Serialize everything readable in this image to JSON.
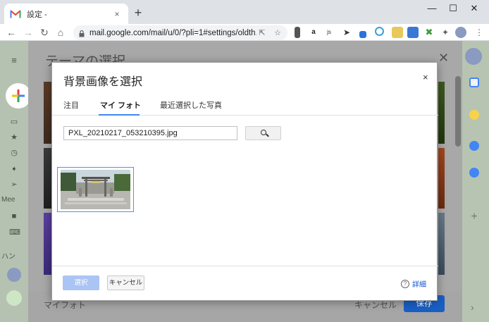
{
  "browser": {
    "tab_title": "設定 -",
    "tab_close": "×",
    "new_tab": "+",
    "window_controls": {
      "minimize": "—",
      "maximize": "☐",
      "close": "✕"
    },
    "nav": {
      "back": "←",
      "forward": "→",
      "reload": "↻",
      "home": "⌂"
    },
    "url": "mail.google.com/mail/u/0/?pli=1#settings/oldth...",
    "extensions": [
      "a",
      "js"
    ]
  },
  "gmail": {
    "left_rail_labels": [
      "Mee",
      "ハン"
    ],
    "theme_dialog_title": "テーマの選択",
    "theme_dialog_close": "✕",
    "footer_left": "マイフォト",
    "footer_cancel": "キャンセル",
    "footer_save": "保存",
    "right_rail_expand": "›"
  },
  "dialog": {
    "title": "背景画像を選択",
    "close": "×",
    "tabs": [
      {
        "label": "注目",
        "active": false
      },
      {
        "label": "マイ フォト",
        "active": true
      },
      {
        "label": "最近選択した写真",
        "active": false
      }
    ],
    "search_value": "PXL_20210217_053210395.jpg",
    "select_button": "選択",
    "cancel_button": "キャンセル",
    "help_icon": "?",
    "help_label": "詳細"
  },
  "colors": {
    "accent": "#4285f4",
    "link": "#1155cc",
    "select_disabled": "#aac4f3",
    "save_button": "#1a5fc4"
  }
}
